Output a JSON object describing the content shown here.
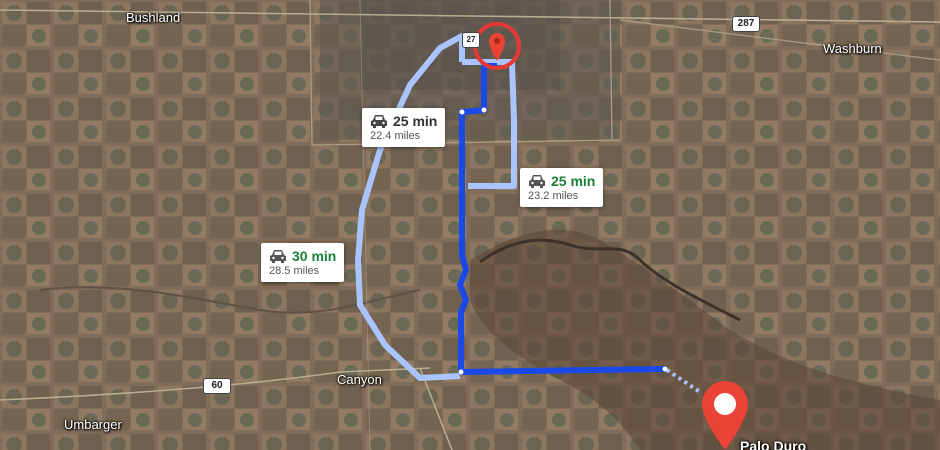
{
  "map": {
    "towns": {
      "bushland": "Bushland",
      "washburn": "Washburn",
      "canyon": "Canyon",
      "umbarger": "Umbarger",
      "palo_duro": "Palo Duro"
    },
    "highway_shields": {
      "us287": "287",
      "us60": "60",
      "i27_top": "27"
    },
    "routes": [
      {
        "time": "25 min",
        "distance": "22.4 miles",
        "selected": true
      },
      {
        "time": "25 min",
        "distance": "23.2 miles",
        "selected": false
      },
      {
        "time": "30 min",
        "distance": "28.5 miles",
        "selected": false
      }
    ],
    "colors": {
      "selected_route": "#1a49e8",
      "alt_route": "#aac4ff",
      "pin": "#ea4335",
      "eta_green": "#188038"
    },
    "icons": {
      "origin": "location-pin-icon",
      "destination": "location-pin-icon",
      "vehicle": "car-icon"
    }
  }
}
